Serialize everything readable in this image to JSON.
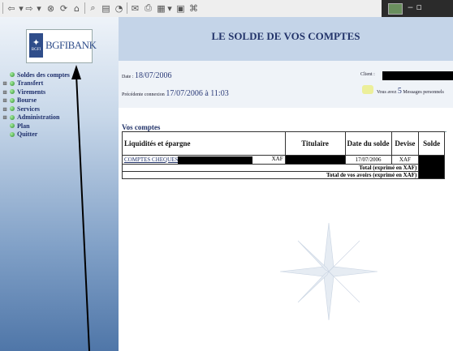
{
  "toolbar": {
    "buttons": [
      "back-icon",
      "forward-icon",
      "stop-icon",
      "refresh-icon",
      "home-icon",
      "search-icon",
      "favorites-icon",
      "history-icon",
      "mail-icon",
      "print-icon",
      "edit-icon"
    ]
  },
  "logo": {
    "badge": "BGFI",
    "text": "BGFIBANK"
  },
  "menu": [
    {
      "label": "Soldes des comptes",
      "expandable": false
    },
    {
      "label": "Transfert",
      "expandable": true
    },
    {
      "label": "Virements",
      "expandable": true
    },
    {
      "label": "Bourse",
      "expandable": true
    },
    {
      "label": "Services",
      "expandable": true
    },
    {
      "label": "Administration",
      "expandable": true
    },
    {
      "label": "Plan",
      "expandable": false
    },
    {
      "label": "Quitter",
      "expandable": false
    }
  ],
  "page": {
    "title": "LE SOLDE DE VOS COMPTES"
  },
  "info": {
    "date_label": "Date : ",
    "date_value": "18/07/2006",
    "conn_label": "Précédente connexion ",
    "conn_value": "17/07/2006 à 11:03",
    "client_label": "Client : ",
    "msg_prefix": "Vous avez ",
    "msg_count": "5",
    "msg_suffix": " Messages personnels"
  },
  "accounts": {
    "section_title": "Vos comptes",
    "headers": [
      "Liquidités et épargne",
      "Titulaire",
      "Date du solde",
      "Devise",
      "Solde"
    ],
    "row": {
      "account": "COMPTES CHEQUES",
      "currency_inline": "XAF",
      "date": "17/07/2006",
      "devise": "XAF"
    },
    "total_label": "Total (exprimé en XAF)",
    "grand_total_label": "Total de vos avoirs (exprimé en XAF)"
  }
}
